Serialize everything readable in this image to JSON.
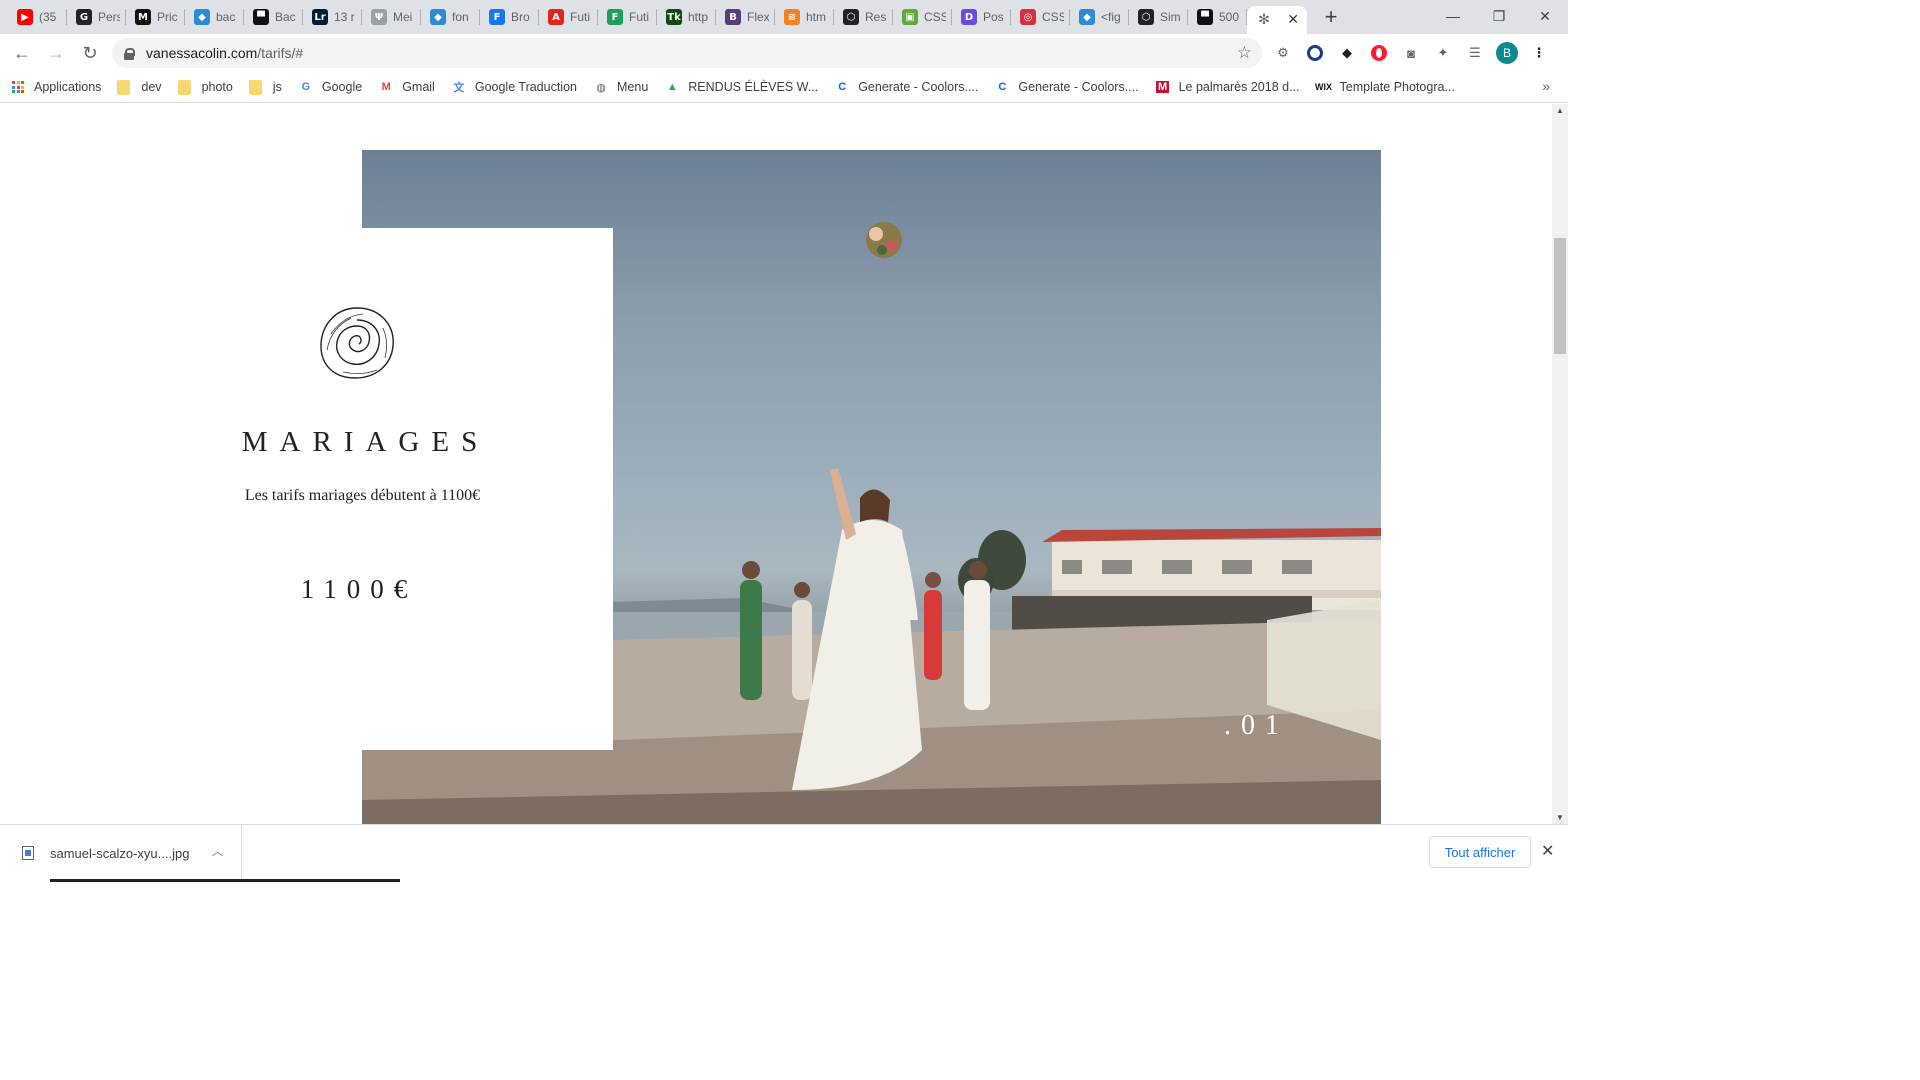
{
  "browser": {
    "tabs": [
      {
        "title": "(35",
        "icon": "youtube-icon",
        "color": "#ff0000",
        "glyph": "▶"
      },
      {
        "title": "Pers",
        "icon": "grammarly-icon",
        "color": "#222222",
        "glyph": "G"
      },
      {
        "title": "Pric",
        "icon": "medium-icon",
        "color": "#111111",
        "glyph": "M"
      },
      {
        "title": "bac",
        "icon": "tailwind-icon",
        "color": "#2a8bd8",
        "glyph": "◆"
      },
      {
        "title": "Bac",
        "icon": "unsplash-icon",
        "color": "#111111",
        "glyph": "▀"
      },
      {
        "title": "13 r",
        "icon": "lightroom-icon",
        "color": "#001e36",
        "glyph": "Lr"
      },
      {
        "title": "Mei",
        "icon": "utensils-icon",
        "color": "#9aa0a6",
        "glyph": "Ψ"
      },
      {
        "title": "fon",
        "icon": "tailwind-icon",
        "color": "#2a8bd8",
        "glyph": "◆"
      },
      {
        "title": "Bro",
        "icon": "facebook-icon",
        "color": "#1877f2",
        "glyph": "F"
      },
      {
        "title": "Futi",
        "icon": "adobe-icon",
        "color": "#e1251b",
        "glyph": "A"
      },
      {
        "title": "Futi",
        "icon": "futura-icon",
        "color": "#1e9e5a",
        "glyph": "F"
      },
      {
        "title": "http",
        "icon": "tk-icon",
        "color": "#0e4d0e",
        "glyph": "Tk"
      },
      {
        "title": "Flex",
        "icon": "bootstrap-icon",
        "color": "#563d7c",
        "glyph": "B"
      },
      {
        "title": "htm",
        "icon": "stackoverflow-icon",
        "color": "#f48024",
        "glyph": "≋"
      },
      {
        "title": "Res",
        "icon": "codepen-icon",
        "color": "#222222",
        "glyph": "⬡"
      },
      {
        "title": "CSS",
        "icon": "css-icon",
        "color": "#5fa93a",
        "glyph": "▣"
      },
      {
        "title": "Pos",
        "icon": "postcss-icon",
        "color": "#6a4ce4",
        "glyph": "D"
      },
      {
        "title": "CSS",
        "icon": "spiral-icon",
        "color": "#d6303a",
        "glyph": "◎"
      },
      {
        "title": "<fig",
        "icon": "tailwind-icon",
        "color": "#2a8bd8",
        "glyph": "◆"
      },
      {
        "title": "Sim",
        "icon": "codepen-icon",
        "color": "#222222",
        "glyph": "⬡"
      },
      {
        "title": "500",
        "icon": "unsplash-icon",
        "color": "#111111",
        "glyph": "▀"
      }
    ],
    "active_tab_icon": "pinwheel-icon",
    "url_host": "vanessacolin.com",
    "url_path": "/tarifs/#",
    "profile_initial": "B"
  },
  "bookmarks": [
    {
      "label": "Applications",
      "type": "apps"
    },
    {
      "label": "dev",
      "type": "folder"
    },
    {
      "label": "photo",
      "type": "folder"
    },
    {
      "label": "js",
      "type": "folder"
    },
    {
      "label": "Google",
      "type": "google"
    },
    {
      "label": "Gmail",
      "type": "gmail"
    },
    {
      "label": "Google Traduction",
      "type": "translate"
    },
    {
      "label": "Menu",
      "type": "globe"
    },
    {
      "label": "RENDUS ÉLÈVES W...",
      "type": "drive"
    },
    {
      "label": "Generate - Coolors....",
      "type": "coolors"
    },
    {
      "label": "Generate - Coolors....",
      "type": "coolors"
    },
    {
      "label": "Le palmarès 2018 d...",
      "type": "magazine"
    },
    {
      "label": "Template Photogra...",
      "type": "wix"
    }
  ],
  "page": {
    "card_title": "MARIAGES",
    "card_subtitle": "Les tarifs mariages débutent à 1100€",
    "card_price": "1100€",
    "photo_index": ".01"
  },
  "download_bar": {
    "filename": "samuel-scalzo-xyu....jpg",
    "show_all_label": "Tout afficher"
  }
}
